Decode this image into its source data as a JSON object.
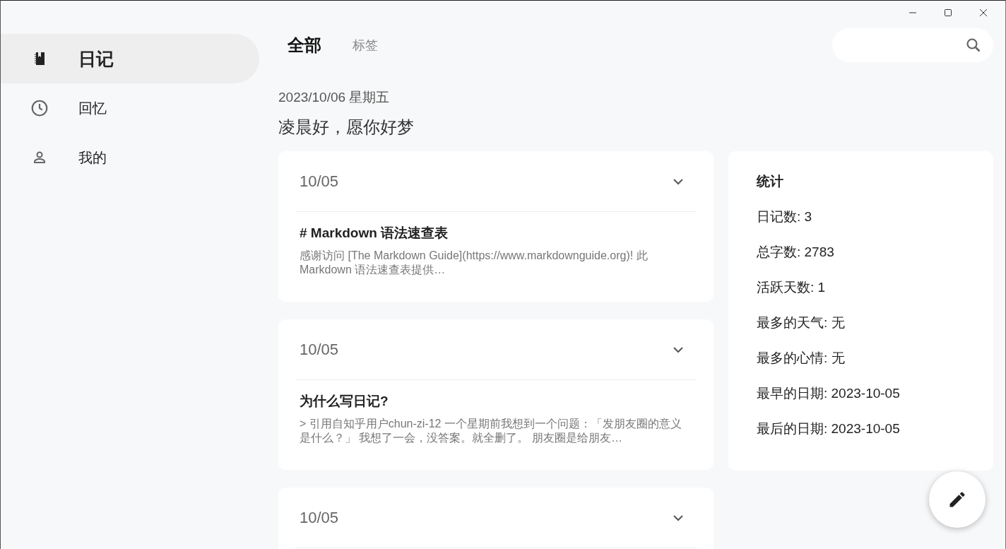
{
  "sidebar": {
    "items": [
      {
        "label": "日记",
        "kind": "notebook",
        "selected": true
      },
      {
        "label": "回忆",
        "kind": "clock",
        "selected": false
      },
      {
        "label": "我的",
        "kind": "person",
        "selected": false
      }
    ]
  },
  "tabs": [
    {
      "label": "全部",
      "selected": true
    },
    {
      "label": "标签",
      "selected": false
    }
  ],
  "date_line": "2023/10/06 星期五",
  "greeting": "凌晨好，愿你好梦",
  "entries": [
    {
      "date": "10/05",
      "title": "# Markdown 语法速查表",
      "excerpt": "感谢访问 [The Markdown Guide](https://www.markdownguide.org)! 此 Markdown 语法速查表提供…"
    },
    {
      "date": "10/05",
      "title": "为什么写日记?",
      "excerpt": "> 引用自知乎用户chun-zi-12 一个星期前我想到一个问题：「发朋友圈的意义是什么？」 我想了一会，没答案。就全删了。 朋友圈是给朋友…"
    },
    {
      "date": "10/05"
    }
  ],
  "stats": {
    "title": "统计",
    "lines": [
      "日记数: 3",
      "总字数: 2783",
      "活跃天数: 1",
      "最多的天气:  无",
      "最多的心情:  无",
      "最早的日期: 2023-10-05",
      "最后的日期: 2023-10-05"
    ]
  }
}
